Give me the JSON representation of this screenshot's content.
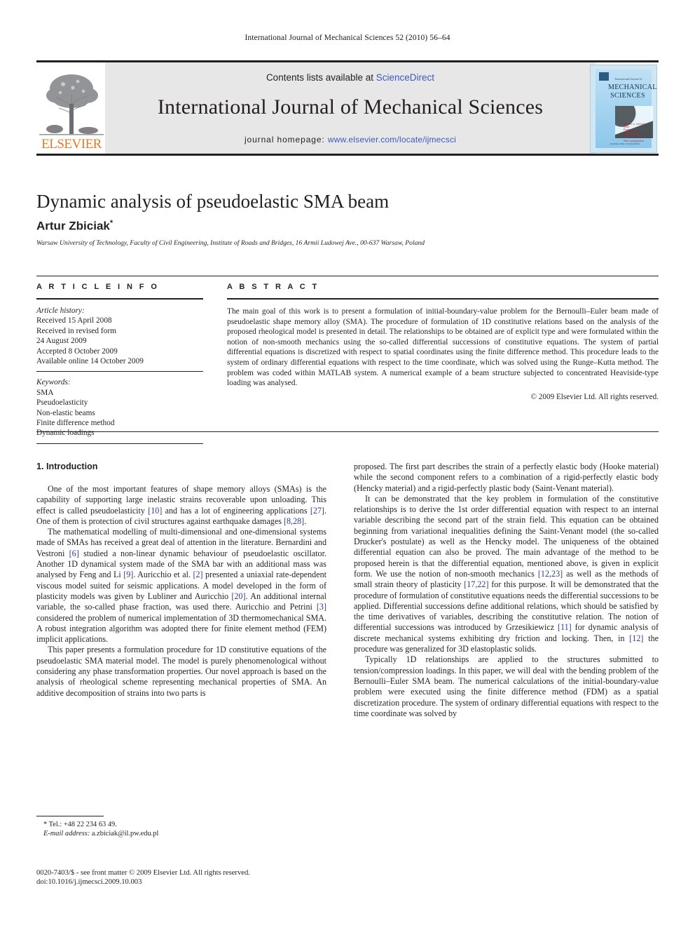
{
  "running_head": "International Journal of Mechanical Sciences 52 (2010) 56–64",
  "banner": {
    "contents_prefix": "Contents lists available at ",
    "sciencedirect": "ScienceDirect",
    "journal_title": "International Journal of Mechanical Sciences",
    "homepage_prefix": "journal homepage: ",
    "homepage_url": "www.elsevier.com/locate/ijmecsci",
    "publisher_wordmark": "ELSEVIER",
    "link_color": "#3b5bbf",
    "wordmark_color": "#e87722",
    "banner_bg": "#e7e7e7"
  },
  "cover": {
    "line_small": "International Journal of",
    "line_1": "MECHANICAL",
    "line_2": "SCIENCES",
    "red_line_1": "Review or refereed fluid",
    "red_line_2": "Forming & processing of materials",
    "red_line_3": "Thermodynamics",
    "red_line_4": "Wave propagation",
    "footer": "Available online at ScienceDirect"
  },
  "title": "Dynamic analysis of pseudoelastic SMA beam",
  "author": "Artur Zbiciak",
  "author_marker": "*",
  "affiliation": "Warsaw University of Technology, Faculty of Civil Engineering, Institute of Roads and Bridges, 16 Armii Ludowej Ave., 00-637 Warsaw, Poland",
  "article_info": {
    "heading": "A R T I C L E   I N F O",
    "history_label": "Article history:",
    "history": [
      "Received 15 April 2008",
      "Received in revised form",
      "24 August 2009",
      "Accepted 8 October 2009",
      "Available online 14 October 2009"
    ],
    "keywords_label": "Keywords:",
    "keywords": [
      "SMA",
      "Pseudoelasticity",
      "Non-elastic beams",
      "Finite difference method",
      "Dynamic loadings"
    ]
  },
  "abstract": {
    "heading": "A B S T R A C T",
    "text": "The main goal of this work is to present a formulation of initial-boundary-value problem for the Bernoulli–Euler beam made of pseudoelastic shape memory alloy (SMA). The procedure of formulation of 1D constitutive relations based on the analysis of the proposed rheological model is presented in detail. The relationships to be obtained are of explicit type and were formulated within the notion of non-smooth mechanics using the so-called differential successions of constitutive equations. The system of partial differential equations is discretized with respect to spatial coordinates using the finite difference method. This procedure leads to the system of ordinary differential equations with respect to the time coordinate, which was solved using the Runge–Kutta method. The problem was coded within MATLAB system. A numerical example of a beam structure subjected to concentrated Heaviside-type loading was analysed.",
    "copyright": "© 2009 Elsevier Ltd. All rights reserved."
  },
  "body": {
    "section_heading": "1. Introduction",
    "left_paragraphs": [
      "One of the most important features of shape memory alloys (SMAs) is the capability of supporting large inelastic strains recoverable upon unloading. This effect is called pseudoelasticity [10] and has a lot of engineering applications [27]. One of them is protection of civil structures against earthquake damages [8,28].",
      "The mathematical modelling of multi-dimensional and one-dimensional systems made of SMAs has received a great deal of attention in the literature. Bernardini and Vestroni [6] studied a non-linear dynamic behaviour of pseudoelastic oscillator. Another 1D dynamical system made of the SMA bar with an additional mass was analysed by Feng and Li [9]. Auricchio et al. [2] presented a uniaxial rate-dependent viscous model suited for seismic applications. A model developed in the form of plasticity models was given by Lubliner and Auricchio [20]. An additional internal variable, the so-called phase fraction, was used there. Auricchio and Petrini [3] considered the problem of numerical implementation of 3D thermomechanical SMA. A robust integration algorithm was adopted there for finite element method (FEM) implicit applications.",
      "This paper presents a formulation procedure for 1D constitutive equations of the pseudoelastic SMA material model. The model is purely phenomenological without considering any phase transformation properties. Our novel approach is based on the analysis of rheological scheme representing mechanical properties of SMA. An additive decomposition of strains into two parts is"
    ],
    "right_paragraphs": [
      "proposed. The first part describes the strain of a perfectly elastic body (Hooke material) while the second component refers to a combination of a rigid-perfectly elastic body (Hencky material) and a rigid-perfectly plastic body (Saint-Venant material).",
      "It can be demonstrated that the key problem in formulation of the constitutive relationships is to derive the 1st order differential equation with respect to an internal variable describing the second part of the strain field. This equation can be obtained beginning from variational inequalities defining the Saint-Venant model (the so-called Drucker's postulate) as well as the Hencky model. The uniqueness of the obtained differential equation can also be proved. The main advantage of the method to be proposed herein is that the differential equation, mentioned above, is given in explicit form. We use the notion of non-smooth mechanics [12,23] as well as the methods of small strain theory of plasticity [17,22] for this purpose. It will be demonstrated that the procedure of formulation of constitutive equations needs the differential successions to be applied. Differential successions define additional relations, which should be satisfied by the time derivatives of variables, describing the constitutive relation. The notion of differential successions was introduced by Grzesikiewicz [11] for dynamic analysis of discrete mechanical systems exhibiting dry friction and locking. Then, in [12] the procedure was generalized for 3D elastoplastic solids.",
      "Typically 1D relationships are applied to the structures submitted to tension/compression loadings. In this paper, we will deal with the bending problem of the Bernoulli–Euler SMA beam. The numerical calculations of the initial-boundary-value problem were executed using the finite difference method (FDM) as a spatial discretization procedure. The system of ordinary differential equations with respect to the time coordinate was solved by"
    ],
    "reference_color": "#2b3e91"
  },
  "footnote": {
    "tel_marker": "*",
    "tel": "Tel.: +48 22 234 63 49.",
    "email_label": "E-mail address:",
    "email": "a.zbiciak@il.pw.edu.pl"
  },
  "imprint": {
    "line1": "0020-7403/$ - see front matter © 2009 Elsevier Ltd. All rights reserved.",
    "line2": "doi:10.1016/j.ijmecsci.2009.10.003"
  }
}
